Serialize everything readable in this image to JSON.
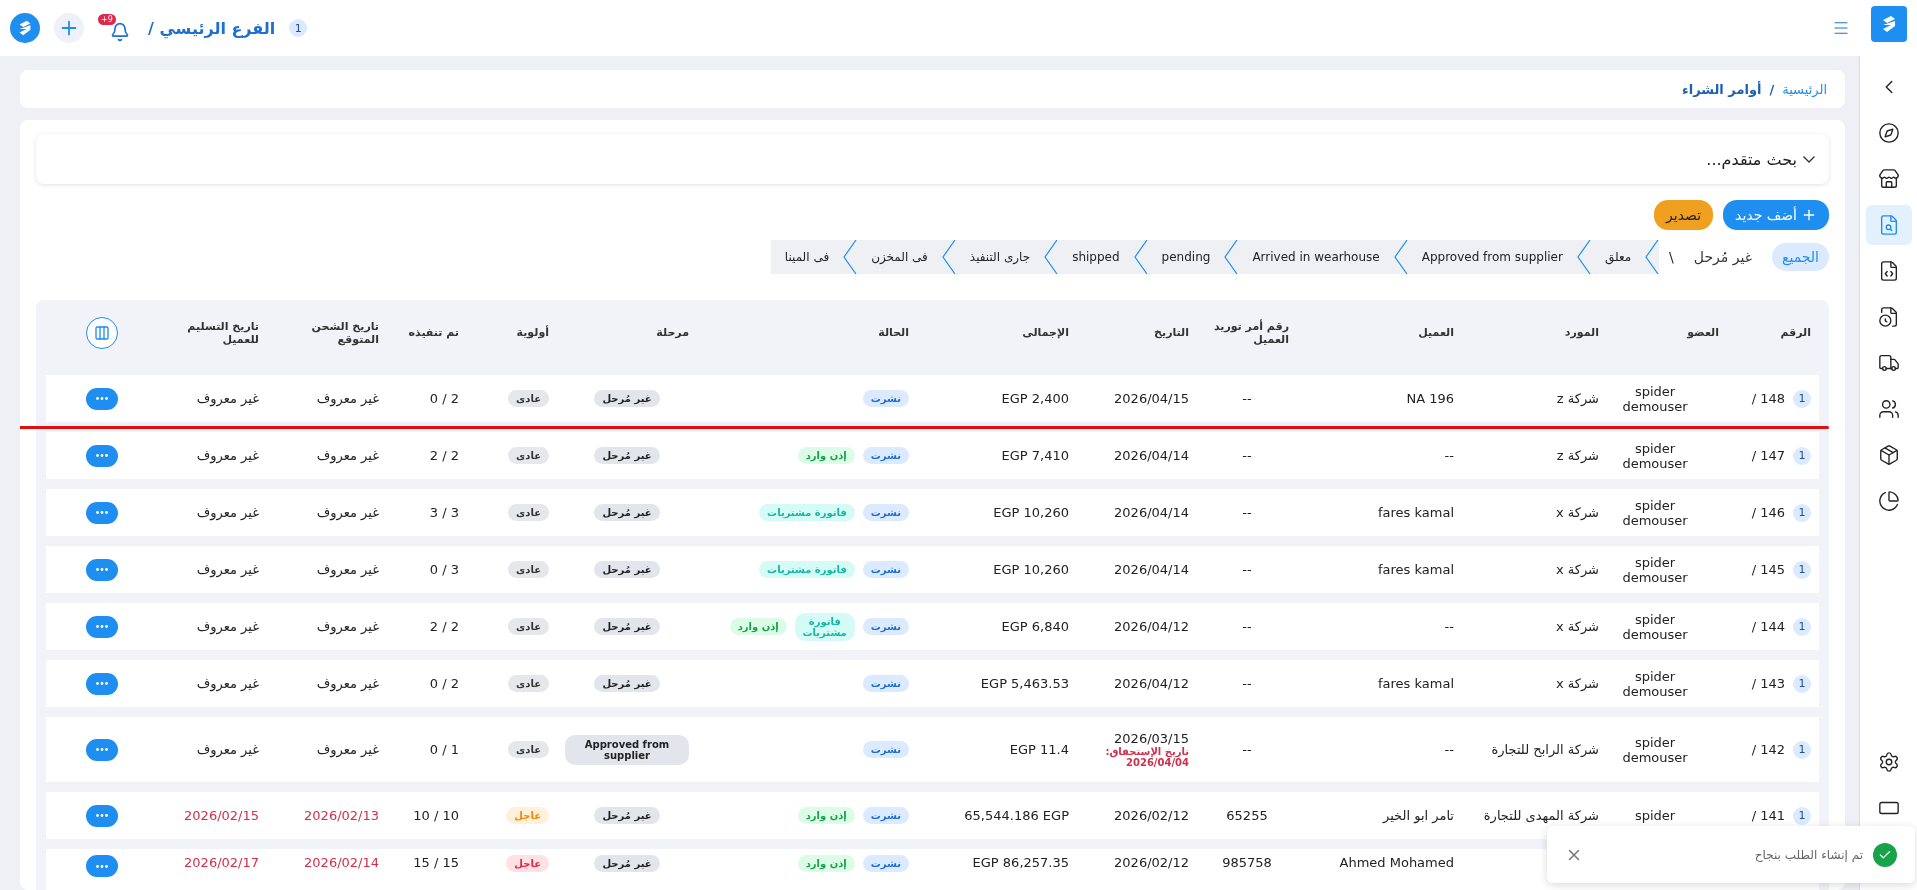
{
  "topbar": {
    "branch_badge": "1",
    "branch": "الفرع الرئيسي /",
    "notifications": "+9"
  },
  "sidebar": [
    {
      "selected": false
    },
    {
      "selected": false
    },
    {
      "selected": true
    },
    {
      "selected": false
    },
    {
      "selected": false
    },
    {
      "selected": false
    },
    {
      "selected": false
    },
    {
      "selected": false
    },
    {
      "selected": false
    }
  ],
  "breadcrumb": [
    {
      "label": "الرئيسية",
      "current": false
    },
    {
      "label": "أوامر الشراء",
      "current": true
    }
  ],
  "breadcrumb_separator": "/",
  "search_panel": {
    "title": "بحث متقدم...",
    "expanded": false
  },
  "actions": {
    "add": "أضف جديد",
    "export": "تصدير"
  },
  "filters": [
    {
      "label": "الجميع",
      "selected": true
    },
    {
      "label": "غير مُرحل",
      "selected": false
    }
  ],
  "filter_separator": "\\",
  "steps": [
    {
      "label": "معلق"
    },
    {
      "label": "Approved from supplier"
    },
    {
      "label": "Arrived in wearhouse"
    },
    {
      "label": "pending"
    },
    {
      "label": "shipped"
    },
    {
      "label": "جارى التنفيذ"
    },
    {
      "label": "فى المخزن"
    },
    {
      "label": "فى المينا"
    }
  ],
  "table": {
    "columns": [
      "الرقم",
      "العضو",
      "المورد",
      "العميل",
      "رقم أمر توريد العميل",
      "التاريخ",
      "الإجمالى",
      "الحالة",
      "مرحلة",
      "أولوية",
      "تم تنفيذه",
      "تاريخ الشحن المتوقع",
      "تاريخ التسليم للعميل"
    ],
    "rows": [
      {
        "number": "148 /",
        "branch": "1",
        "member": "spider demouser",
        "supplier": "شركة z",
        "client": "NA 196",
        "ref": "--",
        "date": "2026/04/15",
        "total": "EGP 2,400",
        "statuses": [
          {
            "label": "نشرت",
            "kind": "published"
          }
        ],
        "stage": "غير مُرحل",
        "priority": {
          "label": "عادى",
          "kind": "normal"
        },
        "done": "0 / 2",
        "ship": "غير معروف",
        "delivery": "غير معروف",
        "overdue": false,
        "marked": true
      },
      {
        "number": "147 /",
        "branch": "1",
        "member": "spider demouser",
        "supplier": "شركة z",
        "client": "--",
        "ref": "--",
        "date": "2026/04/14",
        "total": "EGP 7,410",
        "statuses": [
          {
            "label": "نشرت",
            "kind": "published"
          },
          {
            "label": "إذن وارد",
            "kind": "receipt"
          }
        ],
        "stage": "غير مُرحل",
        "priority": {
          "label": "عادى",
          "kind": "normal"
        },
        "done": "2 / 2",
        "ship": "غير معروف",
        "delivery": "غير معروف",
        "overdue": false,
        "marked": false
      },
      {
        "number": "146 /",
        "branch": "1",
        "member": "spider demouser",
        "supplier": "شركة x",
        "client": "fares kamal",
        "ref": "--",
        "date": "2026/04/14",
        "total": "EGP 10,260",
        "statuses": [
          {
            "label": "نشرت",
            "kind": "published"
          },
          {
            "label": "فاتورة مشتريات",
            "kind": "invoice"
          }
        ],
        "stage": "غير مُرحل",
        "priority": {
          "label": "عادى",
          "kind": "normal"
        },
        "done": "3 / 3",
        "ship": "غير معروف",
        "delivery": "غير معروف",
        "overdue": false,
        "marked": false
      },
      {
        "number": "145 /",
        "branch": "1",
        "member": "spider demouser",
        "supplier": "شركة x",
        "client": "fares kamal",
        "ref": "--",
        "date": "2026/04/14",
        "total": "EGP 10,260",
        "statuses": [
          {
            "label": "نشرت",
            "kind": "published"
          },
          {
            "label": "فاتورة مشتريات",
            "kind": "invoice"
          }
        ],
        "stage": "غير مُرحل",
        "priority": {
          "label": "عادى",
          "kind": "normal"
        },
        "done": "0 / 3",
        "ship": "غير معروف",
        "delivery": "غير معروف",
        "overdue": false,
        "marked": false
      },
      {
        "number": "144 /",
        "branch": "1",
        "member": "spider demouser",
        "supplier": "شركة x",
        "client": "--",
        "ref": "--",
        "date": "2026/04/12",
        "total": "EGP 6,840",
        "statuses": [
          {
            "label": "نشرت",
            "kind": "published"
          },
          {
            "label": "فاتورة مشتريات",
            "kind": "invoice"
          },
          {
            "label": "إذن وارد",
            "kind": "receipt"
          }
        ],
        "stage": "غير مُرحل",
        "priority": {
          "label": "عادى",
          "kind": "normal"
        },
        "done": "2 / 2",
        "ship": "غير معروف",
        "delivery": "غير معروف",
        "overdue": false,
        "marked": false
      },
      {
        "number": "143 /",
        "branch": "1",
        "member": "spider demouser",
        "supplier": "شركة x",
        "client": "fares kamal",
        "ref": "--",
        "date": "2026/04/12",
        "total": "EGP 5,463.53",
        "statuses": [
          {
            "label": "نشرت",
            "kind": "published"
          }
        ],
        "stage": "غير مُرحل",
        "priority": {
          "label": "عادى",
          "kind": "normal"
        },
        "done": "0 / 2",
        "ship": "غير معروف",
        "delivery": "غير معروف",
        "overdue": false,
        "marked": false
      },
      {
        "number": "142 /",
        "branch": "1",
        "member": "spider demouser",
        "supplier": "شركة الرابح للتجارة",
        "client": "--",
        "ref": "--",
        "date": "2026/03/15",
        "due_label": "تاريخ الإستحقاق:",
        "due_date": "2026/04/04",
        "total": "EGP 11.4",
        "statuses": [
          {
            "label": "نشرت",
            "kind": "published"
          }
        ],
        "stage": "Approved from supplier",
        "priority": {
          "label": "عادى",
          "kind": "normal"
        },
        "done": "0 / 1",
        "ship": "غير معروف",
        "delivery": "غير معروف",
        "overdue": false,
        "marked": false
      },
      {
        "number": "141 /",
        "branch": "1",
        "member": "spider",
        "supplier": "شركة المهدى للتجارة",
        "client": "تامر ابو الخير",
        "ref": "65255",
        "date": "2026/02/12",
        "total": "65,544.186 EGP",
        "statuses": [
          {
            "label": "نشرت",
            "kind": "published"
          },
          {
            "label": "إذن وارد",
            "kind": "receipt"
          }
        ],
        "stage": "غير مُرحل",
        "priority": {
          "label": "عاجل",
          "kind": "urgent"
        },
        "done": "10 / 10",
        "ship": "2026/02/13",
        "delivery": "2026/02/15",
        "overdue": true,
        "marked": false
      },
      {
        "client": "Ahmed Mohamed",
        "ref": "985758",
        "date": "2026/02/12",
        "total": "EGP 86,257.35",
        "statuses": [
          {
            "label": "نشرت",
            "kind": "published"
          },
          {
            "label": "إذن وارد",
            "kind": "receipt"
          }
        ],
        "stage": "غير مُرحل",
        "priority": {
          "label": "عاجل",
          "kind": "critical"
        },
        "done": "15 / 15",
        "ship": "2026/02/14",
        "delivery": "2026/02/17",
        "overdue": true,
        "marked": false
      }
    ]
  },
  "toast": {
    "message": "تم إنشاء الطلب بنجاح",
    "kind": "success"
  }
}
